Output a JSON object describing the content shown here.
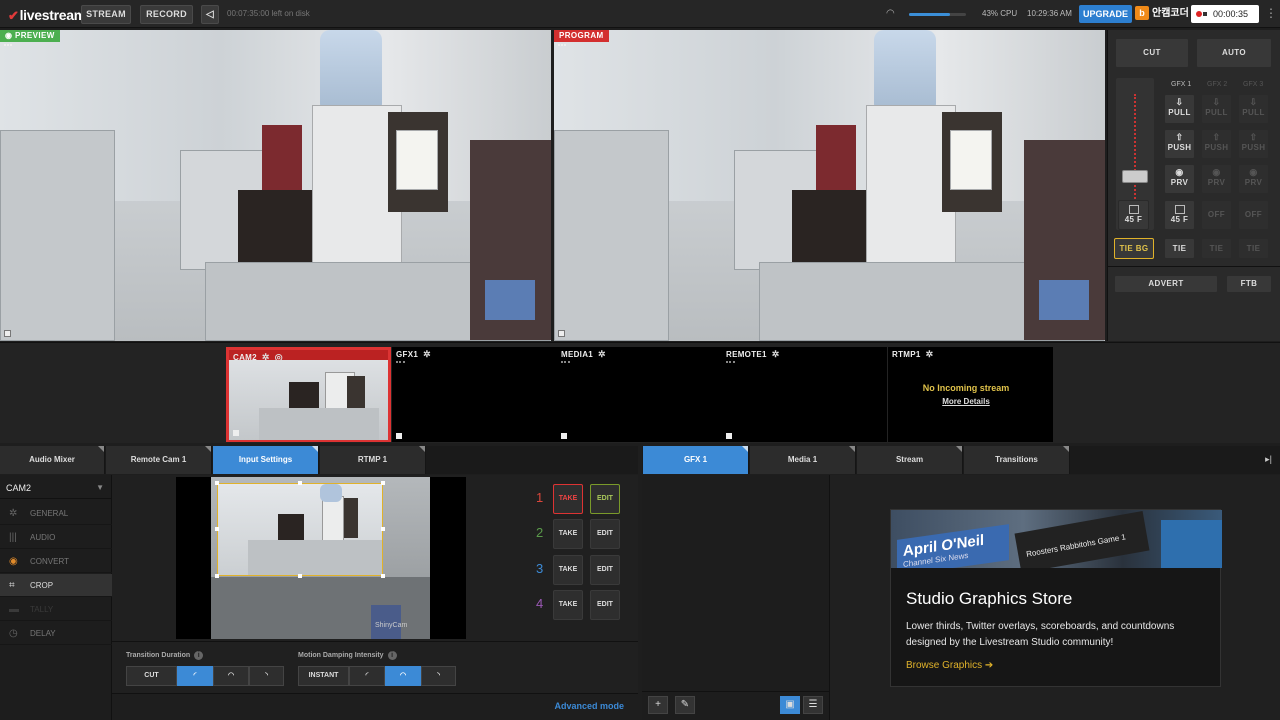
{
  "topbar": {
    "logo": "livestream",
    "stream_label": "STREAM",
    "record_label": "RECORD",
    "share_icon": "share-icon",
    "disk_status": "00:07:35:00 left on disk",
    "volume_level": 0.72,
    "cpu": "43% CPU",
    "time": "10:29:36 AM",
    "upgrade_label": "UPGRADE",
    "korean_label": "안캠코더",
    "rec_time": "00:00:35",
    "more_icon": "more-icon"
  },
  "monitors": {
    "preview_label": "PREVIEW",
    "program_label": "PROGRAM",
    "preview_color": "#4caf50",
    "program_color": "#d32f2f"
  },
  "control": {
    "cut_label": "CUT",
    "auto_label": "AUTO",
    "gfx_headers": [
      "GFX 1",
      "GFX 2",
      "GFX 3"
    ],
    "pull_label": "PULL",
    "push_label": "PUSH",
    "prv_label": "PRV",
    "fade_label": "45 F",
    "off_label": "OFF",
    "tie_bg_label": "TIE BG",
    "tie_label": "TIE",
    "advert_label": "ADVERT",
    "ftb_label": "FTB"
  },
  "bus": {
    "sources": [
      {
        "name": "CAM2",
        "active": true
      },
      {
        "name": "GFX1",
        "active": false
      },
      {
        "name": "MEDIA1",
        "active": false
      },
      {
        "name": "REMOTE1",
        "active": false
      },
      {
        "name": "RTMP1",
        "active": false
      }
    ],
    "no_incoming": "No Incoming stream",
    "more_details": "More Details"
  },
  "left_tabs": [
    "Audio Mixer",
    "Remote Cam 1",
    "Input Settings",
    "RTMP 1"
  ],
  "right_tabs": [
    "GFX 1",
    "Media 1",
    "Stream",
    "Transitions"
  ],
  "input_settings": {
    "camera": "CAM2",
    "menu": [
      {
        "label": "GENERAL",
        "icon": "gear-icon"
      },
      {
        "label": "AUDIO",
        "icon": "audio-bars-icon"
      },
      {
        "label": "CONVERT",
        "icon": "convert-icon"
      },
      {
        "label": "CROP",
        "icon": "crop-icon"
      },
      {
        "label": "TALLY",
        "icon": "tally-icon"
      },
      {
        "label": "DELAY",
        "icon": "clock-icon"
      }
    ],
    "presets": [
      {
        "num": "1",
        "color": "#d9463b"
      },
      {
        "num": "2",
        "color": "#5a9a4a"
      },
      {
        "num": "3",
        "color": "#3c8ad6"
      },
      {
        "num": "4",
        "color": "#9b59b6"
      }
    ],
    "take_label": "TAKE",
    "edit_label": "EDIT",
    "transition_duration_label": "Transition Duration",
    "motion_damping_label": "Motion Damping Intensity",
    "cut_label": "CUT",
    "instant_label": "INSTANT",
    "watermark": "ShinyCam",
    "advanced_mode": "Advanced mode"
  },
  "store": {
    "title": "Studio Graphics Store",
    "description": "Lower thirds, Twitter overlays, scoreboards, and countdowns designed by the Livestream Studio community!",
    "link": "Browse Graphics",
    "banner_name": "April O'Neil",
    "banner_sub": "Channel Six News",
    "banner_team1": "Roosters",
    "banner_team2": "Rabbitohs",
    "banner_game": "Game 1"
  }
}
